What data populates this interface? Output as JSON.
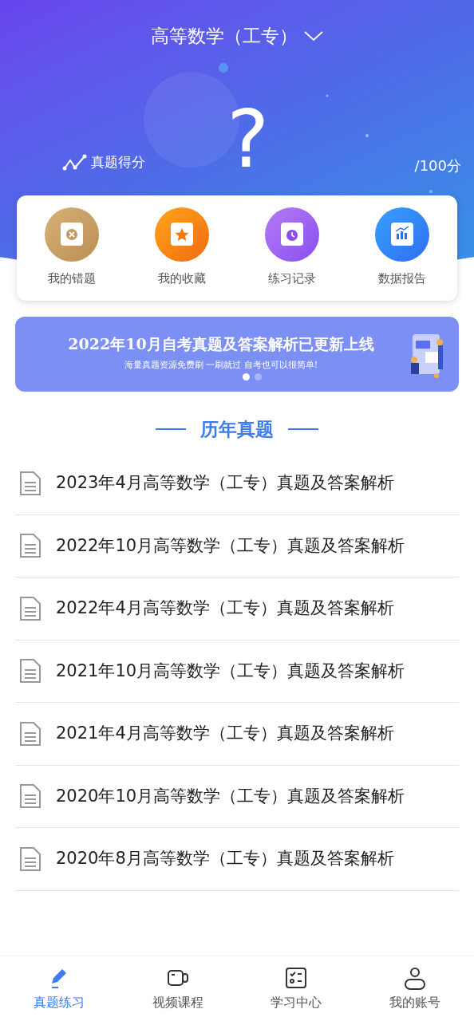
{
  "header": {
    "subject": "高等数学（工专）",
    "score": "?",
    "score_label": "真题得分",
    "score_max": "/100分"
  },
  "shortcuts": [
    {
      "kind": "wrong",
      "label": "我的错题"
    },
    {
      "kind": "favorite",
      "label": "我的收藏"
    },
    {
      "kind": "history",
      "label": "练习记录"
    },
    {
      "kind": "report",
      "label": "数据报告"
    }
  ],
  "banner": {
    "title": "2022年10月自考真题及答案解析已更新上线",
    "subtitle": "海量真题资源免费刷 一刷就过 自考也可以很简单!",
    "dots": [
      {
        "selected": true
      },
      {
        "selected": false
      }
    ]
  },
  "section_title": "历年真题",
  "papers": [
    "2023年4月高等数学（工专）真题及答案解析",
    "2022年10月高等数学（工专）真题及答案解析",
    "2022年4月高等数学（工专）真题及答案解析",
    "2021年10月高等数学（工专）真题及答案解析",
    "2021年4月高等数学（工专）真题及答案解析",
    "2020年10月高等数学（工专）真题及答案解析",
    "2020年8月高等数学（工专）真题及答案解析"
  ],
  "tabs": [
    {
      "kind": "pencil",
      "label": "真题练习",
      "selected": true
    },
    {
      "kind": "video",
      "label": "视频课程",
      "selected": false
    },
    {
      "kind": "checklist",
      "label": "学习中心",
      "selected": false
    },
    {
      "kind": "user",
      "label": "我的账号",
      "selected": false
    }
  ]
}
